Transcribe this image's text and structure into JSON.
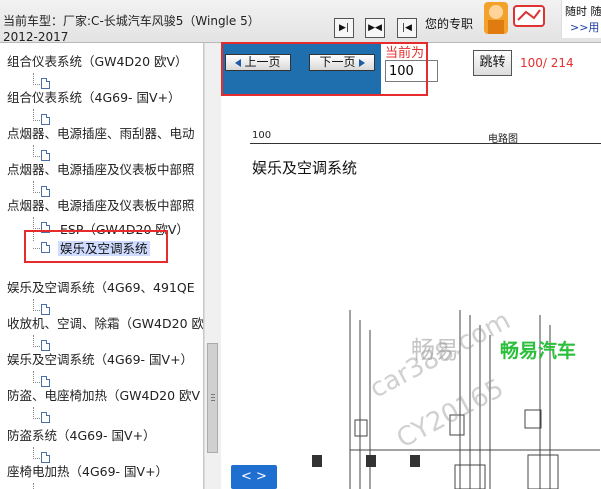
{
  "header": {
    "car_label": "当前车型：",
    "car_value": "厂家:C-长城汽车风骏5（Wingle 5）",
    "car_year": "2012-2017",
    "ad_text": "您的专职",
    "ad_right_line1": "随时 随",
    "ad_right_line2": ">>用"
  },
  "tree": {
    "items": [
      {
        "label": "组合仪表系统（GW4D20 欧V）"
      },
      {
        "label": "组合仪表系统（4G69- 国V+）"
      },
      {
        "label": "点烟器、电源插座、雨刮器、电动"
      },
      {
        "label": "点烟器、电源插座及仪表板中部照"
      },
      {
        "label": "点烟器、电源插座及仪表板中部照"
      },
      {
        "label": "ESP（GW4D20 欧V）"
      },
      {
        "label": "娱乐及空调系统"
      },
      {
        "label": "娱乐及空调系统（4G69、491QE"
      },
      {
        "label": "收放机、空调、除霜（GW4D20 欧"
      },
      {
        "label": "娱乐及空调系统（4G69- 国V+）"
      },
      {
        "label": "防盗、电座椅加热（GW4D20 欧V"
      },
      {
        "label": "防盗系统（4G69- 国V+）"
      },
      {
        "label": "座椅电加热（4G69- 国V+）"
      }
    ],
    "selected_index": 6
  },
  "toolbar": {
    "prev_label": "上一页",
    "next_label": "下一页",
    "current_label": "当前为",
    "page_value": "100",
    "jump_label": "跳转",
    "page_count": "100/ 214"
  },
  "document": {
    "page_number": "100",
    "section": "电路图",
    "title": "娱乐及空调系统",
    "watermark_brand": "畅易汽车",
    "watermark_cn": "畅易",
    "watermark_url": "car388.com",
    "watermark_code": "CY20165"
  },
  "page_nav": {
    "label": "< >"
  },
  "colors": {
    "toolbar_blue": "#1f6fae",
    "highlight_red": "#e52b2b",
    "selected_bg": "#cfdcff",
    "watermark_green": "#2bbf3b"
  }
}
